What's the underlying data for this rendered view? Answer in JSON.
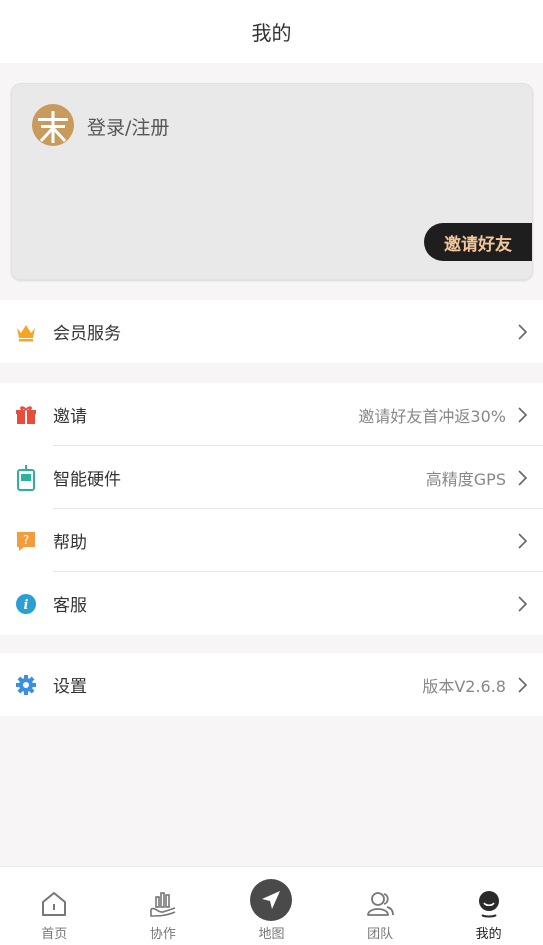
{
  "header": {
    "title": "我的"
  },
  "profile": {
    "login_label": "登录/注册",
    "invite_button": "邀请好友"
  },
  "menu_groups": [
    [
      {
        "label": "会员服务",
        "value": "",
        "icon": "crown-icon"
      }
    ],
    [
      {
        "label": "邀请",
        "value": "邀请好友首冲返30%",
        "icon": "gift-icon"
      },
      {
        "label": "智能硬件",
        "value": "高精度GPS",
        "icon": "gps-device-icon"
      },
      {
        "label": "帮助",
        "value": "",
        "icon": "help-icon"
      },
      {
        "label": "客服",
        "value": "",
        "icon": "info-icon"
      }
    ],
    [
      {
        "label": "设置",
        "value": "版本V2.6.8",
        "icon": "gear-icon"
      }
    ]
  ],
  "tabbar": {
    "items": [
      {
        "label": "首页",
        "icon": "home-icon"
      },
      {
        "label": "协作",
        "icon": "collaborate-icon"
      },
      {
        "label": "地图",
        "icon": "map-navigate-icon"
      },
      {
        "label": "团队",
        "icon": "team-icon"
      },
      {
        "label": "我的",
        "icon": "profile-icon"
      }
    ],
    "active_index": 4
  },
  "colors": {
    "crown": "#f5a623",
    "gift": "#e84c3d",
    "gps": "#2bb39a",
    "help": "#f39c3c",
    "info": "#2a9fd6",
    "gear": "#3a8fe0",
    "invite_text": "#f3c69a",
    "invite_bg": "#1f1e1e"
  }
}
